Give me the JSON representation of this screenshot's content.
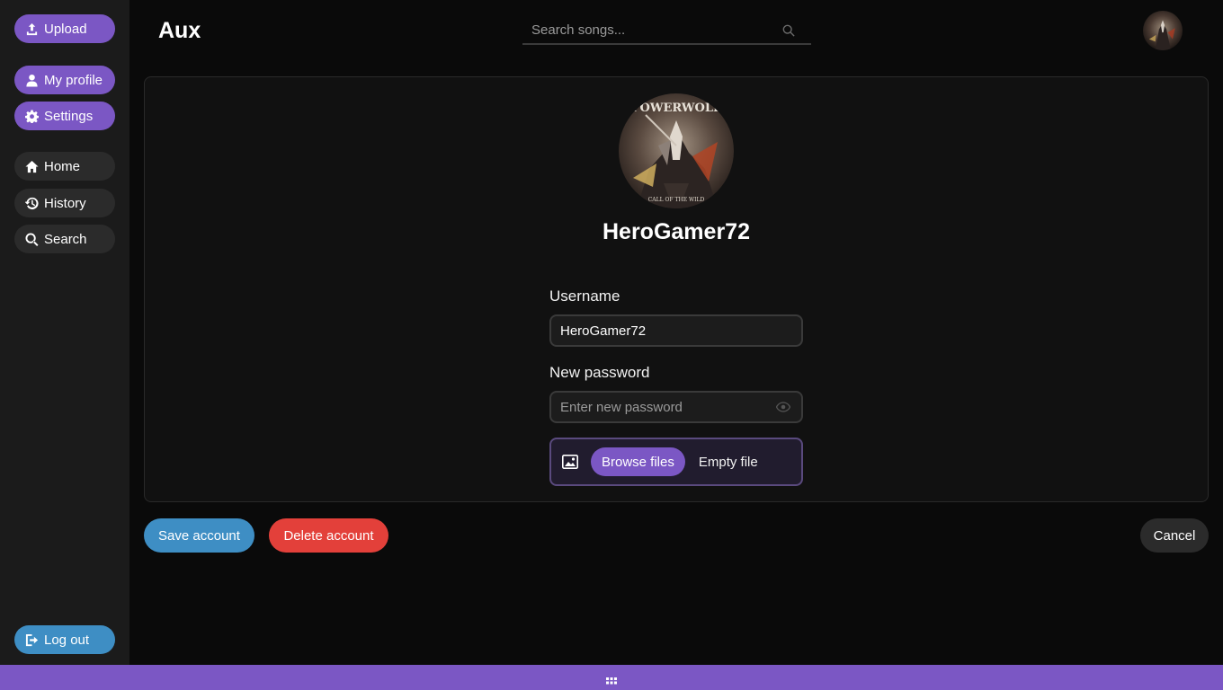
{
  "app": {
    "title": "Aux"
  },
  "sidebar": {
    "upload": "Upload",
    "my_profile": "My profile",
    "settings": "Settings",
    "home": "Home",
    "history": "History",
    "search": "Search",
    "logout": "Log out"
  },
  "search": {
    "placeholder": "Search songs..."
  },
  "profile": {
    "display_name": "HeroGamer72",
    "avatar_text_top": "POWERWOLF",
    "avatar_text_bottom": "CALL OF THE WILD"
  },
  "form": {
    "username_label": "Username",
    "username_value": "HeroGamer72",
    "password_label": "New password",
    "password_placeholder": "Enter new password",
    "browse_label": "Browse files",
    "file_status": "Empty file"
  },
  "actions": {
    "save": "Save account",
    "delete": "Delete account",
    "cancel": "Cancel"
  },
  "colors": {
    "accent_purple": "#7b57c4",
    "save_blue": "#3e8ec4",
    "delete_red": "#e3403a",
    "background": "#0a0a0a",
    "sidebar": "#1b1b1b"
  }
}
